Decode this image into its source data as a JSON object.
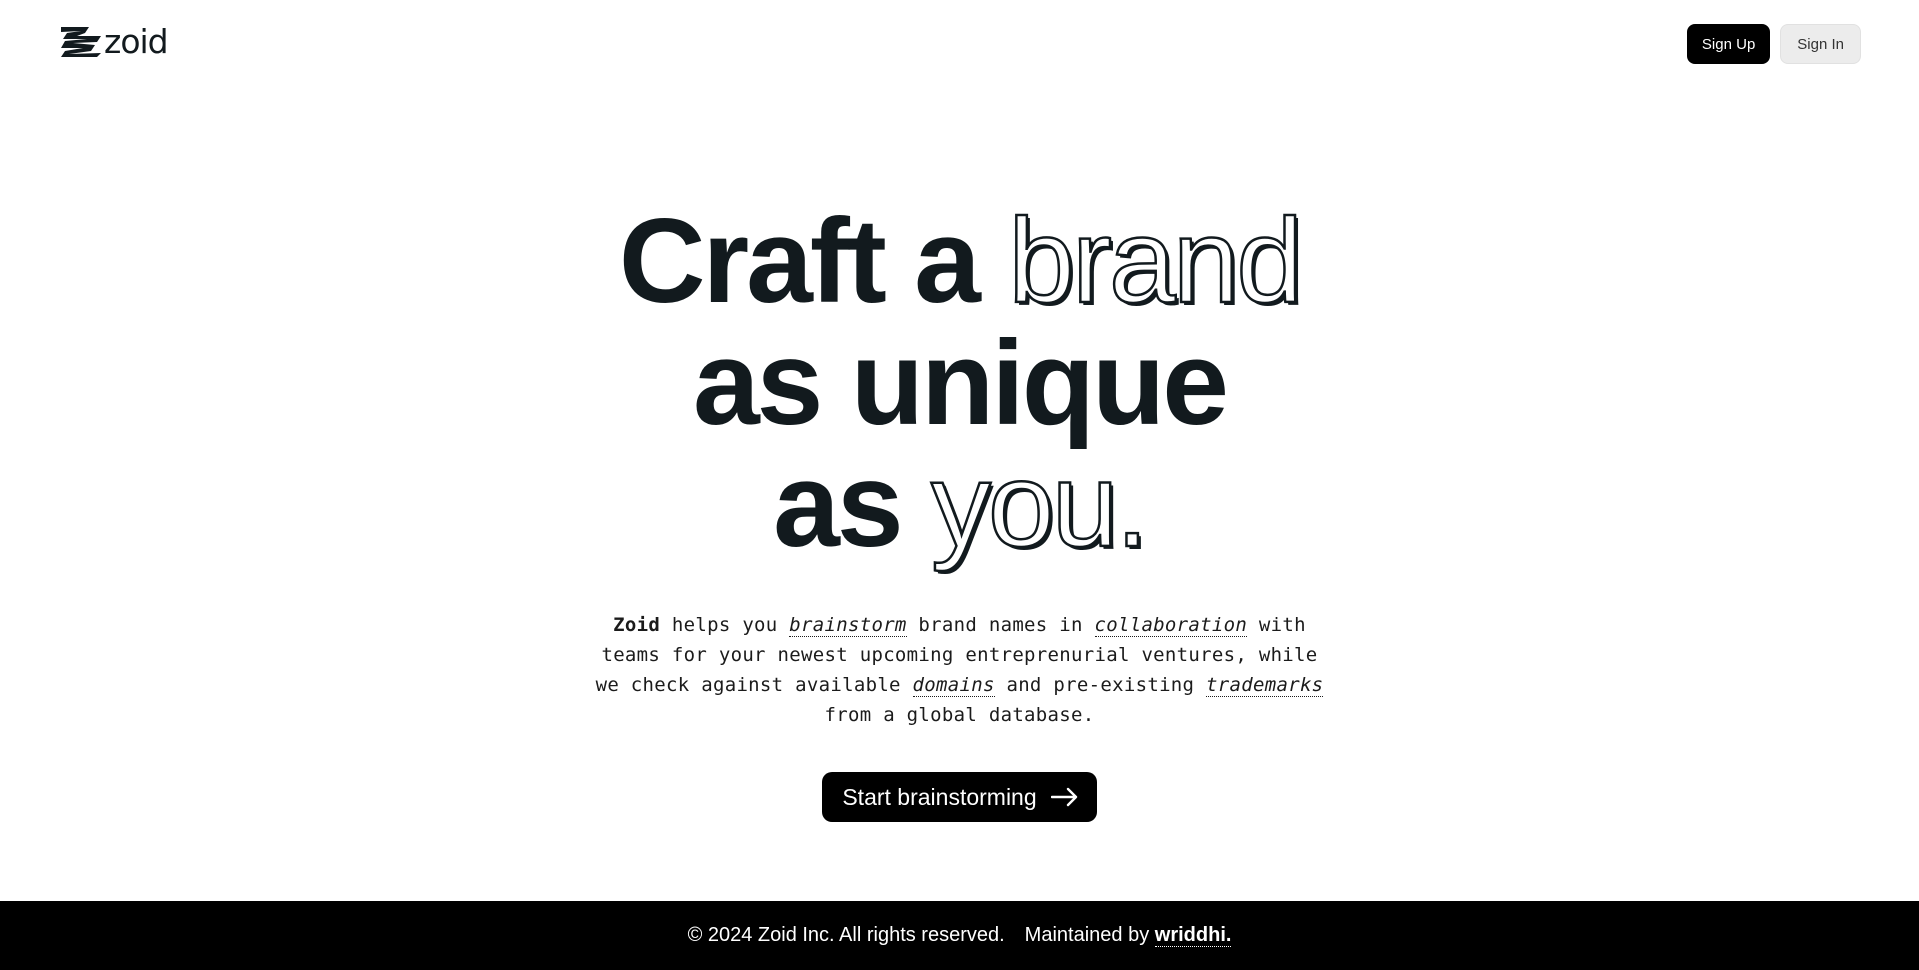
{
  "brand": {
    "name": "zoid",
    "logo_icon": "zoid-zigzag-icon"
  },
  "nav": {
    "signup_label": "Sign Up",
    "signin_label": "Sign In"
  },
  "hero": {
    "line1_plain": "Craft a ",
    "line1_outline": "brand",
    "line2_plain": "as unique",
    "line3_plain": "as ",
    "line3_outline": "you.",
    "description": {
      "brand": "Zoid",
      "seg1": " helps you ",
      "term1": "brainstorm",
      "seg2": " brand names in ",
      "term2": "collaboration",
      "seg3": " with teams for your newest upcoming entreprenurial ventures, while we check against available ",
      "term3": "domains",
      "seg4": " and pre-existing ",
      "term4": "trademarks",
      "seg5": " from a global database."
    },
    "cta_label": "Start brainstorming",
    "cta_icon": "arrow-right-icon"
  },
  "footer": {
    "copyright": "© 2024 Zoid Inc. All rights reserved.",
    "maintained_prefix": "Maintained by",
    "maintainer": "wriddhi."
  },
  "colors": {
    "primary_text": "#121a1e",
    "button_dark": "#000000",
    "button_light": "#ececec",
    "footer_bg": "#000000"
  }
}
